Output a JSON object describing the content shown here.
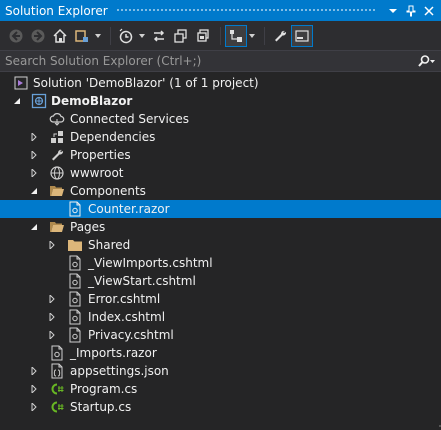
{
  "window": {
    "title": "Solution Explorer"
  },
  "search": {
    "placeholder": "Search Solution Explorer (Ctrl+;)"
  },
  "tree": {
    "solution": "Solution 'DemoBlazor' (1 of 1 project)",
    "project": "DemoBlazor",
    "items": {
      "connected_services": "Connected Services",
      "dependencies": "Dependencies",
      "properties": "Properties",
      "wwwroot": "wwwroot",
      "components": "Components",
      "counter": "Counter.razor",
      "pages": "Pages",
      "shared": "Shared",
      "viewimports": "_ViewImports.cshtml",
      "viewstart": "_ViewStart.cshtml",
      "error": "Error.cshtml",
      "index": "Index.cshtml",
      "privacy": "Privacy.cshtml",
      "imports": "_Imports.razor",
      "appsettings": "appsettings.json",
      "program": "Program.cs",
      "startup": "Startup.cs"
    }
  },
  "colors": {
    "accent": "#007acc",
    "background": "#252526",
    "folder": "#dcb67a",
    "csharp": "#68b723"
  }
}
